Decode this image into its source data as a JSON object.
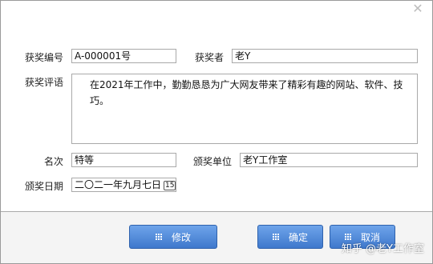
{
  "window": {
    "close_glyph": "✕"
  },
  "form": {
    "award_no": {
      "label": "获奖编号",
      "value": "A-000001号"
    },
    "winner": {
      "label": "获奖者",
      "value": "老Y"
    },
    "comment": {
      "label": "获奖评语",
      "value": "在2021年工作中，勤勤恳恳为广大网友带来了精彩有趣的网站、软件、技巧。"
    },
    "rank": {
      "label": "名次",
      "value": "特等"
    },
    "issuer": {
      "label": "颁奖单位",
      "value": "老Y工作室"
    },
    "date": {
      "label": "颁奖日期",
      "value": "二〇二一年九月七日",
      "icon": "calendar-icon"
    }
  },
  "buttons": {
    "edit": "修改",
    "ok": "确定",
    "cancel": "取消"
  },
  "watermark": "知乎 @老Y工作室"
}
